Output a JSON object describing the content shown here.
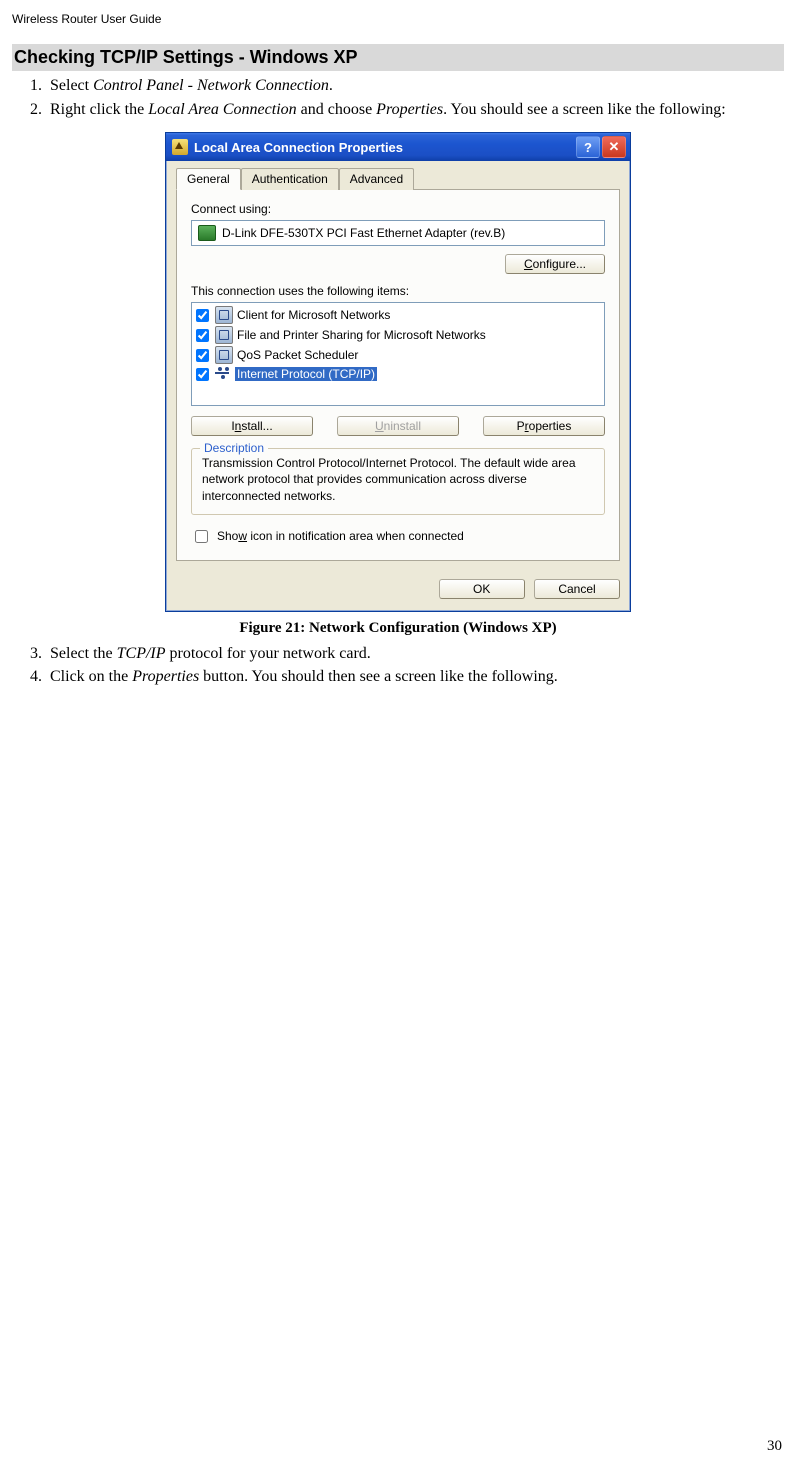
{
  "header": "Wireless Router User Guide",
  "section_title": "Checking TCP/IP Settings - Windows XP",
  "steps_a": {
    "s1_pre": "Select ",
    "s1_em": "Control Panel - Network Connection",
    "s1_post": ".",
    "s2_pre": "Right click the ",
    "s2_em1": "Local Area Connection",
    "s2_mid": " and choose ",
    "s2_em2": "Properties",
    "s2_post": ". You should see a screen like the following:"
  },
  "dialog": {
    "title": "Local Area Connection Properties",
    "help_symbol": "?",
    "close_symbol": "✕",
    "tabs": [
      "General",
      "Authentication",
      "Advanced"
    ],
    "connect_using_label": "Connect using:",
    "adapter": "D-Link DFE-530TX PCI Fast Ethernet Adapter (rev.B)",
    "configure_btn": "Configure...",
    "uses_label": "This connection uses the following items:",
    "items": [
      "Client for Microsoft Networks",
      "File and Printer Sharing for Microsoft Networks",
      "QoS Packet Scheduler",
      "Internet Protocol (TCP/IP)"
    ],
    "install_btn": "Install...",
    "uninstall_btn": "Uninstall",
    "properties_btn": "Properties",
    "desc_legend": "Description",
    "desc_text": "Transmission Control Protocol/Internet Protocol. The default wide area network protocol that provides communication across diverse interconnected networks.",
    "show_icon_label": "Show icon in notification area when connected",
    "ok_btn": "OK",
    "cancel_btn": "Cancel"
  },
  "figure_caption": "Figure 21: Network Configuration (Windows  XP)",
  "steps_b": {
    "s3_pre": "Select the ",
    "s3_em": "TCP/IP",
    "s3_post": " protocol for your network card.",
    "s4_pre": "Click on the ",
    "s4_em": "Properties",
    "s4_post": " button. You should then see a screen like the following."
  },
  "page_number": "30"
}
